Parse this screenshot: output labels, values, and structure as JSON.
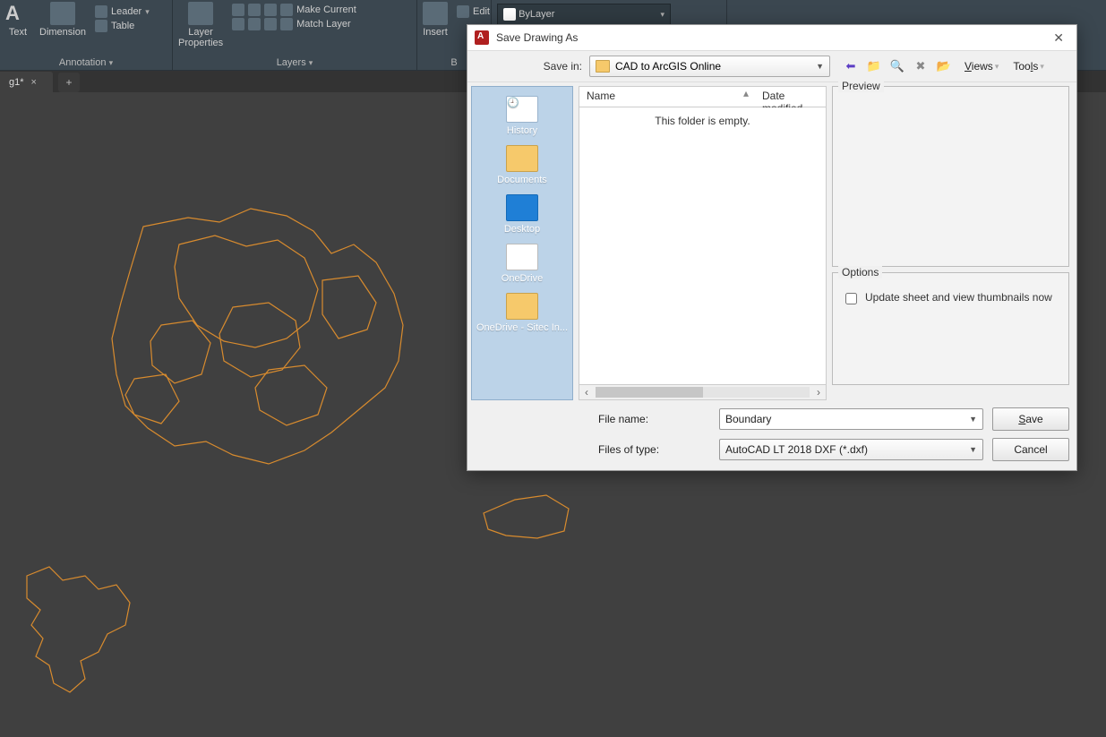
{
  "ribbon": {
    "annotation": {
      "label": "Annotation",
      "text_btn": "Text",
      "dimension_btn": "Dimension",
      "leader": "Leader",
      "table": "Table"
    },
    "layers": {
      "label": "Layers",
      "layer_props": "Layer\nProperties",
      "make_current": "Make Current",
      "match_layer": "Match Layer",
      "combo_value": "ByLayer"
    },
    "insert": {
      "btn": "Insert",
      "edit": "Edit"
    }
  },
  "tab": {
    "name": "g1*",
    "close": "×",
    "add": "+"
  },
  "dialog": {
    "title": "Save Drawing As",
    "save_in_label": "Save in:",
    "save_in_value": "CAD to ArcGIS Online",
    "views": "Views",
    "tools": "Tools",
    "places": {
      "history": "History",
      "documents": "Documents",
      "desktop": "Desktop",
      "onedrive": "OneDrive",
      "onedrive_sitec": "OneDrive - Sitec In..."
    },
    "columns": {
      "name": "Name",
      "date": "Date modified"
    },
    "empty_msg": "This folder is empty.",
    "preview_label": "Preview",
    "options_label": "Options",
    "update_thumbs": "Update sheet and view thumbnails now",
    "file_name_label": "File name:",
    "file_name_value": "Boundary",
    "file_type_label": "Files of type:",
    "file_type_value": "AutoCAD LT 2018 DXF (*.dxf)",
    "save_btn": "Save",
    "cancel_btn": "Cancel"
  }
}
